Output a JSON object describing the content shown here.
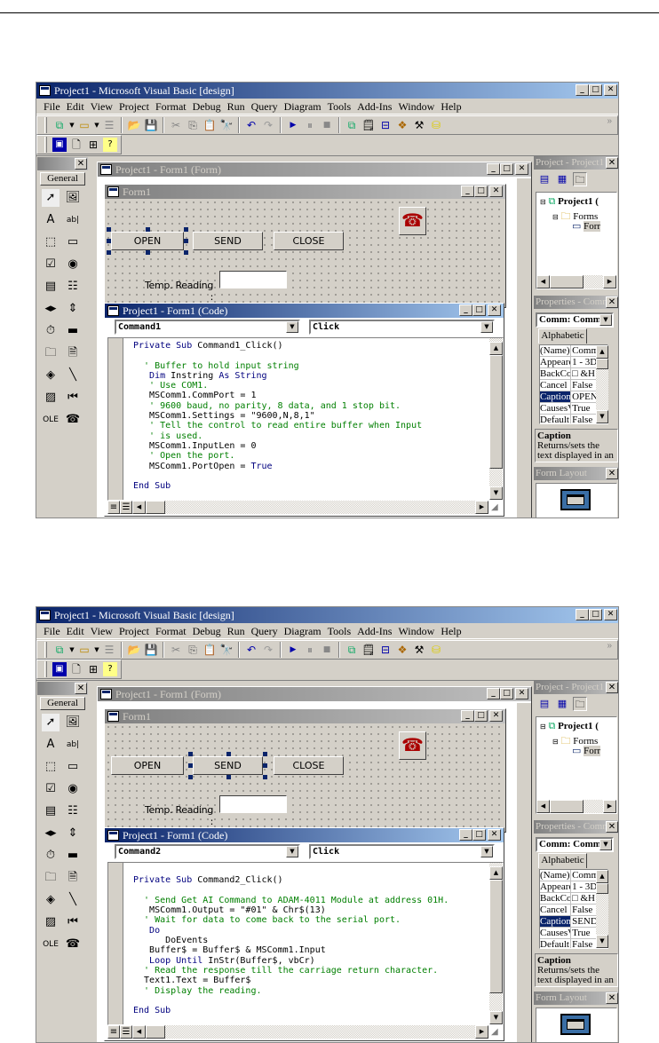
{
  "shots": [
    {
      "app_title": "Project1 - Microsoft Visual Basic [design]",
      "menu": [
        "File",
        "Edit",
        "View",
        "Project",
        "Format",
        "Debug",
        "Run",
        "Query",
        "Diagram",
        "Tools",
        "Add-Ins",
        "Window",
        "Help"
      ],
      "toolbox": {
        "general_label": "General",
        "tools": [
          "pointer-icon",
          "picturebox-icon",
          "label-icon",
          "textbox-icon",
          "frame-icon",
          "commandbutton-icon",
          "checkbox-icon",
          "optionbutton-icon",
          "combobox-icon",
          "listbox-icon",
          "hscrollbar-icon",
          "vscrollbar-icon",
          "timer-icon",
          "drivelistbox-icon",
          "dirlistbox-icon",
          "filelistbox-icon",
          "shape-icon",
          "line-icon",
          "image-icon",
          "data-icon",
          "ole-icon",
          "mscomm-icon"
        ]
      },
      "form_window_title": "Project1 - Form1 (Form)",
      "form_title": "Form1",
      "buttons": {
        "open": "OPEN",
        "send": "SEND",
        "close": "CLOSE"
      },
      "selected_button": "open",
      "temp_label": "Temp. Reading :",
      "temp_value": "",
      "code_window_title": "Project1 - Form1 (Code)",
      "object_combo": "Command1",
      "proc_combo": "Click",
      "code": [
        [
          [
            "kw",
            "Private Sub "
          ],
          [
            "tx",
            "Command1_Click()"
          ]
        ],
        [],
        [
          [
            "cm",
            "  ' Buffer to hold input string"
          ]
        ],
        [
          [
            "kw",
            "   Dim "
          ],
          [
            "tx",
            "Instring "
          ],
          [
            "kw",
            "As String"
          ]
        ],
        [
          [
            "cm",
            "   ' Use COM1."
          ]
        ],
        [
          [
            "tx",
            "   MSComm1.CommPort = 1"
          ]
        ],
        [
          [
            "cm",
            "   ' 9600 baud, no parity, 8 data, and 1 stop bit."
          ]
        ],
        [
          [
            "tx",
            "   MSComm1.Settings = \"9600,N,8,1\""
          ]
        ],
        [
          [
            "cm",
            "   ' Tell the control to read entire buffer when Input"
          ]
        ],
        [
          [
            "cm",
            "   ' is used."
          ]
        ],
        [
          [
            "tx",
            "   MSComm1.InputLen = 0"
          ]
        ],
        [
          [
            "cm",
            "   ' Open the port."
          ]
        ],
        [
          [
            "tx",
            "   MSComm1.PortOpen = "
          ],
          [
            "kw",
            "True"
          ]
        ],
        [],
        [
          [
            "kw",
            "End Sub"
          ]
        ]
      ],
      "project": {
        "title": "Project - Project1",
        "root": "Project1 (",
        "folder": "Forms",
        "item": "Forr"
      },
      "properties": {
        "title": "Properties - Comm",
        "combo": "Comm: Comm",
        "tab": "Alphabetic",
        "rows": [
          [
            "(Name)",
            "Comm"
          ],
          [
            "Appeare",
            "1 - 3D"
          ],
          [
            "BackCo",
            "□ &H"
          ],
          [
            "Cancel",
            "False"
          ],
          [
            "Caption",
            "OPEN"
          ],
          [
            "CausesV",
            "True"
          ],
          [
            "Default",
            "False"
          ]
        ],
        "selected_row": 4,
        "desc_title": "Caption",
        "desc_text": "Returns/sets the text displayed in an"
      },
      "form_layout_title": "Form Layout"
    },
    {
      "app_title": "Project1 - Microsoft Visual Basic [design]",
      "menu": [
        "File",
        "Edit",
        "View",
        "Project",
        "Format",
        "Debug",
        "Run",
        "Query",
        "Diagram",
        "Tools",
        "Add-Ins",
        "Window",
        "Help"
      ],
      "toolbox": {
        "general_label": "General",
        "tools": [
          "pointer-icon",
          "picturebox-icon",
          "label-icon",
          "textbox-icon",
          "frame-icon",
          "commandbutton-icon",
          "checkbox-icon",
          "optionbutton-icon",
          "combobox-icon",
          "listbox-icon",
          "hscrollbar-icon",
          "vscrollbar-icon",
          "timer-icon",
          "drivelistbox-icon",
          "dirlistbox-icon",
          "filelistbox-icon",
          "shape-icon",
          "line-icon",
          "image-icon",
          "data-icon",
          "ole-icon",
          "mscomm-icon"
        ]
      },
      "form_window_title": "Project1 - Form1 (Form)",
      "form_title": "Form1",
      "buttons": {
        "open": "OPEN",
        "send": "SEND",
        "close": "CLOSE"
      },
      "selected_button": "send",
      "temp_label": "Temp. Reading :",
      "temp_value": "",
      "code_window_title": "Project1 - Form1 (Code)",
      "object_combo": "Command2",
      "proc_combo": "Click",
      "code": [
        [],
        [
          [
            "kw",
            "Private Sub "
          ],
          [
            "tx",
            "Command2_Click()"
          ]
        ],
        [],
        [
          [
            "cm",
            "  ' Send Get AI Command to ADAM-4011 Module at address 01H."
          ]
        ],
        [
          [
            "tx",
            "   MSComm1.Output = \"#01\" & Chr$(13)"
          ]
        ],
        [
          [
            "cm",
            "  ' Wait for data to come back to the serial port."
          ]
        ],
        [
          [
            "kw",
            "   Do"
          ]
        ],
        [
          [
            "tx",
            "      DoEvents"
          ]
        ],
        [
          [
            "tx",
            "   Buffer$ = Buffer$ & MSComm1.Input"
          ]
        ],
        [
          [
            "kw",
            "   Loop Until "
          ],
          [
            "tx",
            "InStr(Buffer$, vbCr)"
          ]
        ],
        [
          [
            "cm",
            "  ' Read the response till the carriage return character."
          ]
        ],
        [
          [
            "tx",
            "  Text1.Text = Buffer$"
          ]
        ],
        [
          [
            "cm",
            "  ' Display the reading."
          ]
        ],
        [],
        [
          [
            "kw",
            "End Sub"
          ]
        ]
      ],
      "project": {
        "title": "Project - Project1",
        "root": "Project1 (",
        "folder": "Forms",
        "item": "Forr"
      },
      "properties": {
        "title": "Properties - Comm",
        "combo": "Comm: Comm",
        "tab": "Alphabetic",
        "rows": [
          [
            "(Name)",
            "Comm"
          ],
          [
            "Appeare",
            "1 - 3D"
          ],
          [
            "BackCo",
            "□ &H"
          ],
          [
            "Cancel",
            "False"
          ],
          [
            "Caption",
            "SEND"
          ],
          [
            "CausesV",
            "True"
          ],
          [
            "Default",
            "False"
          ]
        ],
        "selected_row": 4,
        "desc_title": "Caption",
        "desc_text": "Returns/sets the text displayed in an"
      },
      "form_layout_title": "Form Layout"
    }
  ]
}
